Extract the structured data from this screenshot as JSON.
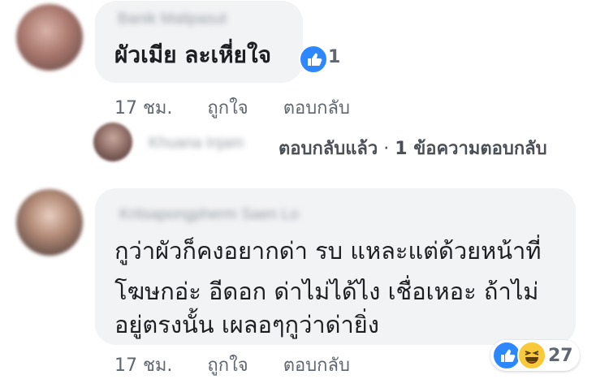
{
  "comments": [
    {
      "author": "Banik Malipasut",
      "lines": [
        "ผัวเมีย ละเหี่ยใจ"
      ],
      "time": "17 ชม.",
      "like_label": "ถูกใจ",
      "reply_label": "ตอบกลับ",
      "reactions": [
        "like"
      ],
      "reaction_count": "1"
    },
    {
      "author": "Kritsapongpherm Saen Lo",
      "lines": [
        "กูว่าผัวก็คงอยากด่า รบ แหละแต่ด้วยหน้าที่",
        "โฆษกอ่ะ อีดอก ด่าไม่ได้ไง เชื่อเหอะ ถ้าไม่",
        "อยู่ตรงนั้น เผลอๆกูว่าด่ายิ่ง"
      ],
      "time": "17 ชม.",
      "like_label": "ถูกใจ",
      "reply_label": "ตอบกลับ",
      "reactions": [
        "like",
        "haha"
      ],
      "reaction_count": "27"
    }
  ],
  "reply_summary": {
    "author": "Khuana Injam",
    "replied_label": "ตอบกลับแล้ว",
    "separator": "·",
    "count_label": "1 ข้อความตอบกลับ"
  },
  "colors": {
    "like": "#2d88ff",
    "haha": "#f7c93b",
    "bubble": "#f2f3f5"
  },
  "icons": {
    "like": "thumbs-up-icon",
    "haha": "laughing-face-icon"
  }
}
